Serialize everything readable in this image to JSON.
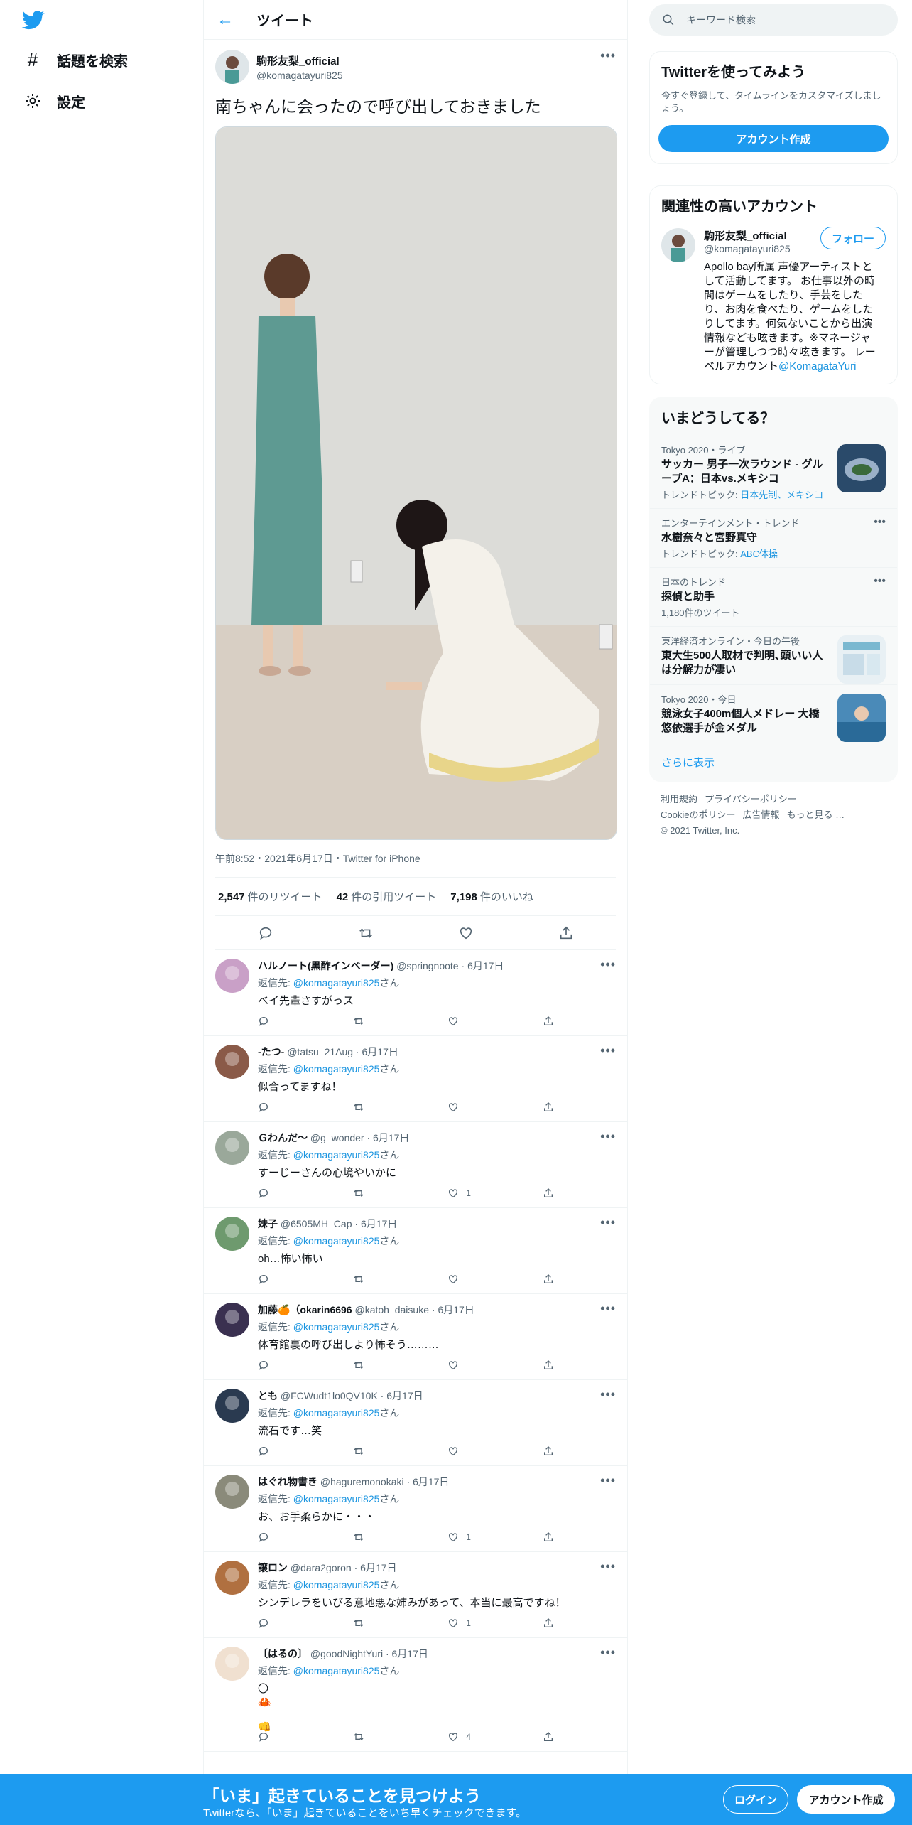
{
  "nav": {
    "explore_label": "話題を検索",
    "settings_label": "設定"
  },
  "header": {
    "title": "ツイート"
  },
  "tweet": {
    "author_name": "駒形友梨_official",
    "author_handle": "@komagatayuri825",
    "text": "南ちゃんに会ったので呼び出しておきました",
    "meta": "午前8:52・2021年6月17日・Twitter for iPhone",
    "retweets": "2,547",
    "retweets_label": "件のリツイート",
    "quotes": "42",
    "quotes_label": "件の引用ツイート",
    "likes": "7,198",
    "likes_label": "件のいいね"
  },
  "reply_prefix": "返信先: ",
  "reply_suffix": "さん",
  "replies": [
    {
      "name": "ハルノート(黒酢インベーダー)",
      "handle": "@springnoote",
      "date": "6月17日",
      "to": "@komagatayuri825",
      "text": "ベイ先輩さすがっス",
      "likes": ""
    },
    {
      "name": "-たつ-",
      "handle": "@tatsu_21Aug",
      "date": "6月17日",
      "to": "@komagatayuri825",
      "text": "似合ってますね！",
      "likes": ""
    },
    {
      "name": "Ｇわんだ～",
      "handle": "@g_wonder",
      "date": "6月17日",
      "to": "@komagatayuri825",
      "text": "すーじーさんの心境やいかに",
      "likes": "1"
    },
    {
      "name": "妹子",
      "handle": "@6505MH_Cap",
      "date": "6月17日",
      "to": "@komagatayuri825",
      "text": "oh…怖い怖い",
      "likes": ""
    },
    {
      "name": "加藤🍊（okarin6696",
      "handle": "@katoh_daisuke",
      "date": "6月17日",
      "to": "@komagatayuri825",
      "text": "体育館裏の呼び出しより怖そう………",
      "likes": ""
    },
    {
      "name": "とも",
      "handle": "@FCWudt1lo0QV10K",
      "date": "6月17日",
      "to": "@komagatayuri825",
      "text": "流石です…笑",
      "likes": ""
    },
    {
      "name": "はぐれ物書き",
      "handle": "@haguremonokaki",
      "date": "6月17日",
      "to": "@komagatayuri825",
      "text": "お、お手柔らかに・・・",
      "likes": "1"
    },
    {
      "name": "譲ロン",
      "handle": "@dara2goron",
      "date": "6月17日",
      "to": "@komagatayuri825",
      "text": "シンデレラをいびる意地悪な姉みがあって、本当に最高ですね！",
      "likes": "1"
    },
    {
      "name": "〔はるの〕",
      "handle": "@goodNightYuri",
      "date": "6月17日",
      "to": "@komagatayuri825",
      "text": "〇\n🦀\n\n👊",
      "likes": "4"
    }
  ],
  "search": {
    "placeholder": "キーワード検索"
  },
  "signup_card": {
    "title": "Twitterを使ってみよう",
    "subtitle": "今すぐ登録して、タイムラインをカスタマイズしましょう。",
    "button": "アカウント作成"
  },
  "related": {
    "title": "関連性の高いアカウント",
    "name": "駒形友梨_official",
    "handle": "@komagatayuri825",
    "follow": "フォロー",
    "bio": "Apollo bay所属 声優アーティストとして活動してます。 お仕事以外の時間はゲームをしたり、手芸をしたり、お肉を食べたり、ゲームをしたりしてます。何気ないことから出演情報なども呟きます。※マネージャーが管理しつつ時々呟きます。 レーベルアカウント",
    "bio_link": "@KomagataYuri"
  },
  "trends": {
    "title": "いまどうしてる？",
    "items": [
      {
        "cat": "Tokyo 2020・ライブ",
        "title": "サッカー 男子一次ラウンド - グループA：日本vs.メキシコ",
        "sub": "トレンドトピック: ",
        "links": "日本先制、メキシコ",
        "thumb": "stadium"
      },
      {
        "cat": "エンターテインメント・トレンド",
        "title": "水樹奈々と宮野真守",
        "sub": "トレンドトピック: ",
        "links": "ABC体操",
        "thumb": ""
      },
      {
        "cat": "日本のトレンド",
        "title": "探偵と助手",
        "sub": "1,180件のツイート",
        "links": "",
        "thumb": ""
      },
      {
        "cat": "東洋経済オンライン・今日の午後",
        "title": "東大生500人取材で判明､頭いい人は分解力が凄い",
        "sub": "",
        "links": "",
        "thumb": "paper"
      },
      {
        "cat": "Tokyo 2020・今日",
        "title": "競泳女子400m個人メドレー 大橋悠依選手が金メダル",
        "sub": "",
        "links": "",
        "thumb": "pool"
      }
    ],
    "show_more": "さらに表示"
  },
  "footer": {
    "links": [
      "利用規約",
      "プライバシーポリシー",
      "Cookieのポリシー",
      "広告情報",
      "もっと見る …"
    ],
    "copyright": "© 2021 Twitter, Inc."
  },
  "bottom": {
    "title": "「いま」起きていることを見つけよう",
    "subtitle": "Twitterなら、「いま」起きていることをいち早くチェックできます。",
    "login": "ログイン",
    "signup": "アカウント作成"
  },
  "colors": {
    "accent": "#1d9bf0",
    "text": "#0f1419",
    "muted": "#536471"
  }
}
